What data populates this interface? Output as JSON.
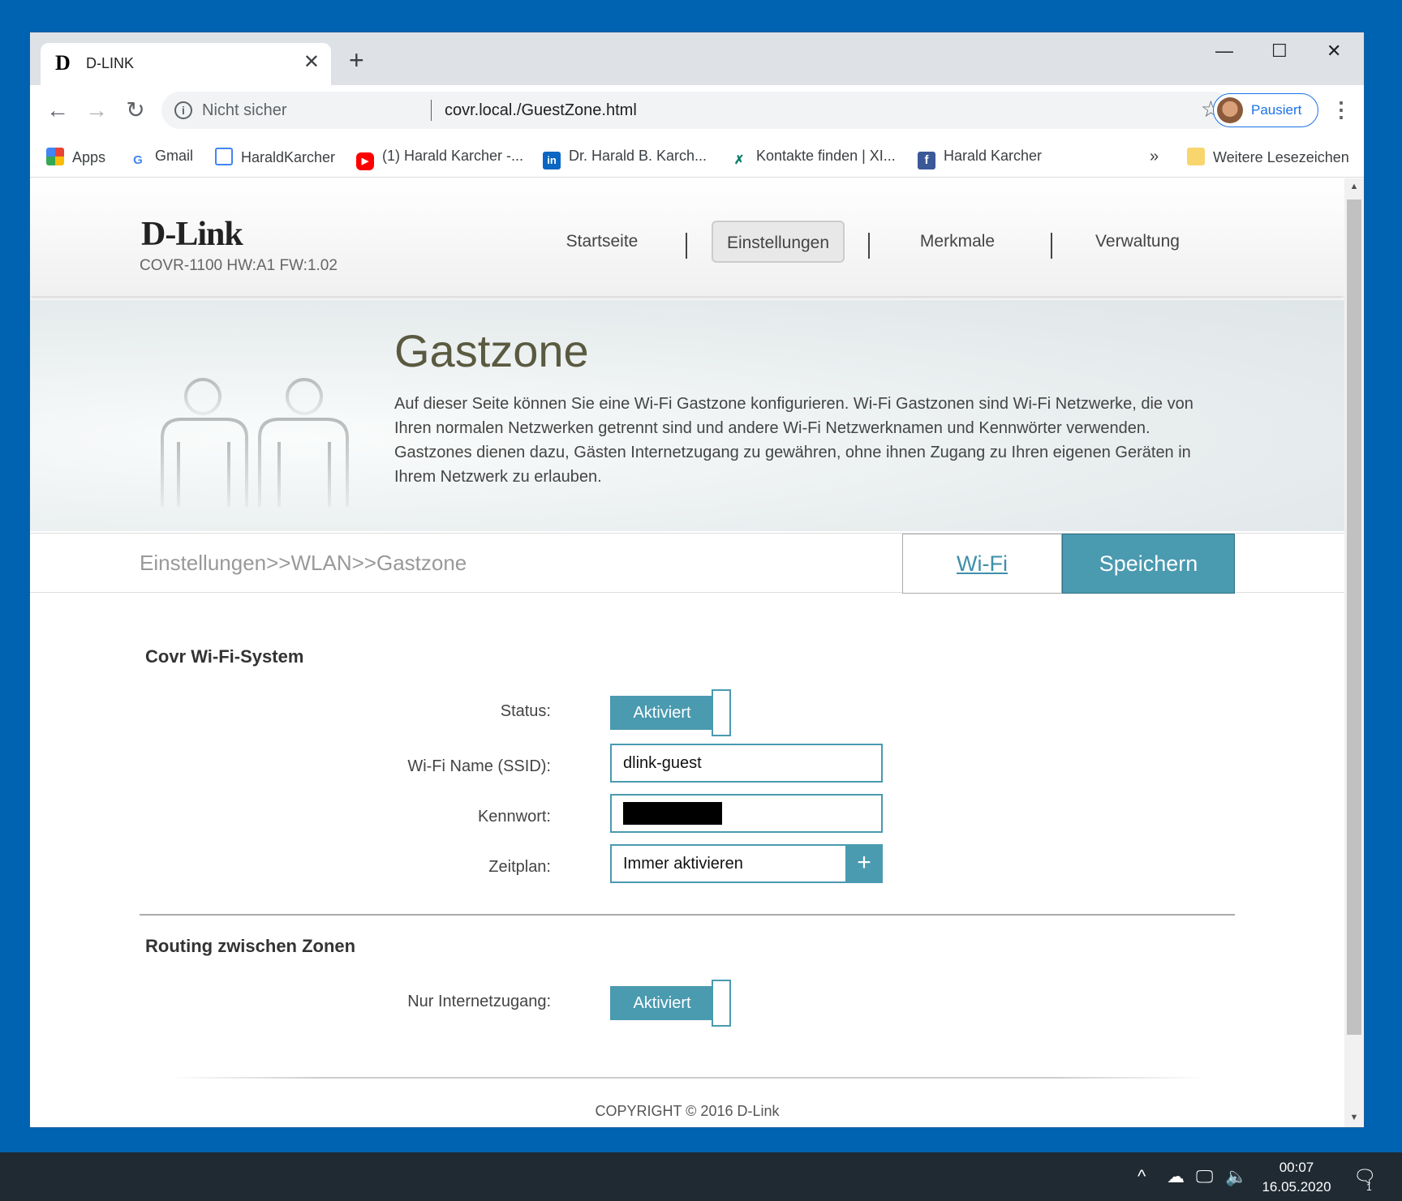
{
  "browser": {
    "tab_title": "D-LINK",
    "tab_favicon": "D",
    "new_tab_label": "+",
    "security_label": "Nicht sicher",
    "url": "covr.local./GuestZone.html",
    "profile_label": "Pausiert",
    "bookmarks": [
      {
        "label": "Apps",
        "icon": "apps-grid-icon"
      },
      {
        "label": "Gmail",
        "icon": "google-icon"
      },
      {
        "label": "HaraldKarcher",
        "icon": "page-icon"
      },
      {
        "label": "(1) Harald Karcher -...",
        "icon": "youtube-icon"
      },
      {
        "label": "Dr. Harald B. Karch...",
        "icon": "linkedin-icon"
      },
      {
        "label": "Kontakte finden | XI...",
        "icon": "xing-icon"
      },
      {
        "label": "Harald Karcher",
        "icon": "facebook-icon"
      }
    ],
    "bookmarks_overflow": "»",
    "other_bookmarks": "Weitere Lesezeichen"
  },
  "page": {
    "logo": "D-Link",
    "model_info": "COVR-1100 HW:A1 FW:1.02",
    "nav": [
      "Startseite",
      "Einstellungen",
      "Merkmale",
      "Verwaltung"
    ],
    "active_nav": "Einstellungen",
    "hero_title": "Gastzone",
    "hero_text": "Auf dieser Seite können Sie eine Wi-Fi Gastzone konfigurieren. Wi-Fi Gastzonen sind Wi-Fi Netzwerke, die von Ihren normalen Netzwerken getrennt sind und andere Wi-Fi Netzwerknamen und Kennwörter verwenden. Gastzones dienen dazu, Gästen Internetzugang zu gewähren, ohne ihnen Zugang zu Ihren eigenen Geräten in Ihrem Netzwerk zu erlauben.",
    "breadcrumb": "Einstellungen>>WLAN>>Gastzone",
    "wifi_link": "Wi-Fi",
    "save_button": "Speichern",
    "section1_title": "Covr Wi-Fi-System",
    "status_label": "Status:",
    "status_value": "Aktiviert",
    "ssid_label": "Wi-Fi Name (SSID):",
    "ssid_value": "dlink-guest",
    "password_label": "Kennwort:",
    "schedule_label": "Zeitplan:",
    "schedule_value": "Immer aktivieren",
    "schedule_add": "+",
    "section2_title": "Routing zwischen Zonen",
    "internet_only_label": "Nur Internetzugang:",
    "internet_only_value": "Aktiviert",
    "copyright": "COPYRIGHT © 2016 D-Link"
  },
  "taskbar": {
    "time": "00:07",
    "date": "16.05.2020",
    "notification_count": "1"
  },
  "colors": {
    "accent": "#4a9ab0",
    "desktop": "#0063b1",
    "title_text": "#5a5a40"
  }
}
